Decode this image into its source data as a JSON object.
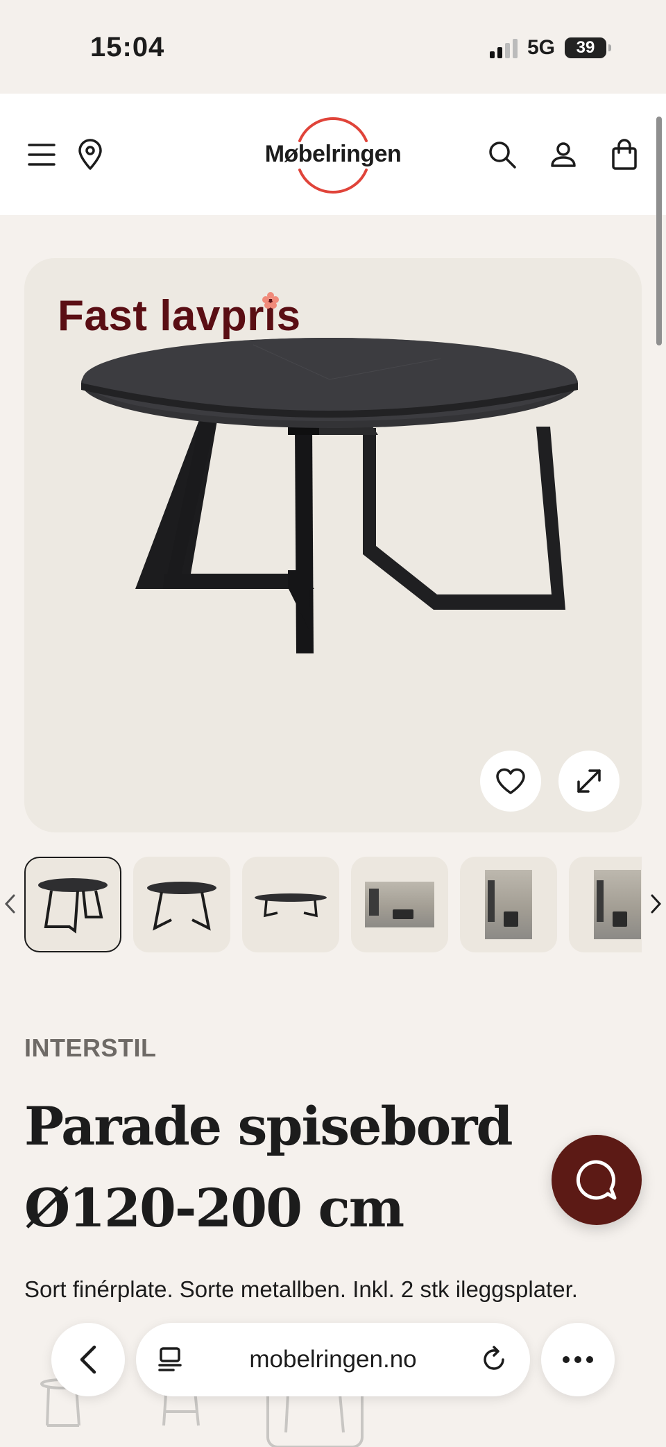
{
  "status": {
    "time": "15:04",
    "network": "5G",
    "battery": "39"
  },
  "header": {
    "logo": "Møbelringen"
  },
  "product": {
    "badge": "Fast lavpris",
    "brand": "INTERSTIL",
    "title": "Parade spisebord Ø120-200 cm",
    "description": "Sort finérplate. Sorte metallben. Inkl. 2 stk ileggsplater."
  },
  "gallery": {
    "thumbnail_count": 6,
    "selected_index": 0
  },
  "browser": {
    "url": "mobelringen.no"
  },
  "colors": {
    "badge": "#5a0e14",
    "chat": "#5c1a15",
    "logo_ring": "#e0443a"
  },
  "icons": [
    "menu-icon",
    "location-pin-icon",
    "search-icon",
    "user-icon",
    "shopping-bag-icon",
    "heart-icon",
    "expand-icon",
    "chevron-left-icon",
    "chevron-right-icon",
    "chat-icon",
    "back-icon",
    "tabs-icon",
    "reload-icon",
    "more-icon"
  ]
}
